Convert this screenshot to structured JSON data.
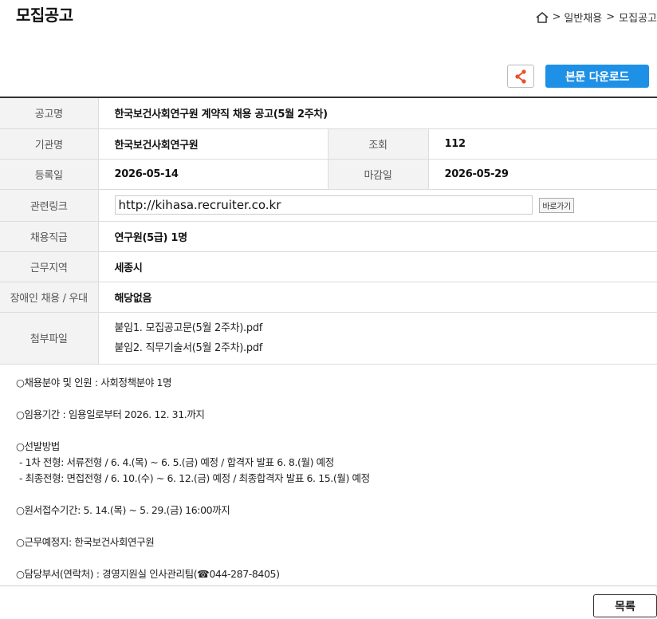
{
  "header": {
    "title": "모집공고",
    "breadcrumb": [
      ">",
      "일반채용",
      ">",
      "모집공고"
    ]
  },
  "toolbar": {
    "download_label": "본문 다운로드"
  },
  "info": {
    "title_label": "공고명",
    "title_value": "한국보건사회연구원 계약직 채용 공고(5월 2주차)",
    "org_label": "기관명",
    "org_value": "한국보건사회연구원",
    "views_label": "조회",
    "views_value": "112",
    "reg_label": "등록일",
    "reg_value": "2026-05-14",
    "deadline_label": "마감일",
    "deadline_value": "2026-05-29",
    "link_label": "관련링크",
    "link_value": "http://kihasa.recruiter.co.kr",
    "go_label": "바로가기",
    "position_label": "채용직급",
    "position_value": "연구원(5급) 1명",
    "region_label": "근무지역",
    "region_value": "세종시",
    "disabled_label": "장애인 채용 / 우대",
    "disabled_value": "해당없음",
    "attach_label": "첨부파일",
    "attachments": [
      "붙임1. 모집공고문(5월 2주차).pdf",
      "붙임2. 직무기술서(5월 2주차).pdf"
    ]
  },
  "body": {
    "field": "○채용분야 및 인원 : 사회정책분야 1명",
    "period": "○임용기간 : 임용일로부터 2026. 12. 31.까지",
    "selection": "○선발방법",
    "sel1": "- 1차 전형: 서류전형 / 6. 4.(목) ~ 6. 5.(금) 예정 / 합격자 발표 6. 8.(월) 예정",
    "sel2": "- 최종전형: 면접전형 / 6. 10.(수) ~ 6. 12.(금) 예정 / 최종합격자 발표 6. 15.(월) 예정",
    "apply": "○원서접수기간: 5. 14.(목) ~ 5. 29.(금) 16:00까지",
    "workplace": "○근무예정지: 한국보건사회연구원",
    "contact": "○담당부서(연락처) : 경영지원실 인사관리팀(☎044-287-8405)"
  },
  "footer": {
    "list_label": "목록"
  },
  "icons": {
    "home": "home-icon",
    "share": "share-icon"
  },
  "colors": {
    "accent": "#1e90e6",
    "share": "#e8522a"
  }
}
